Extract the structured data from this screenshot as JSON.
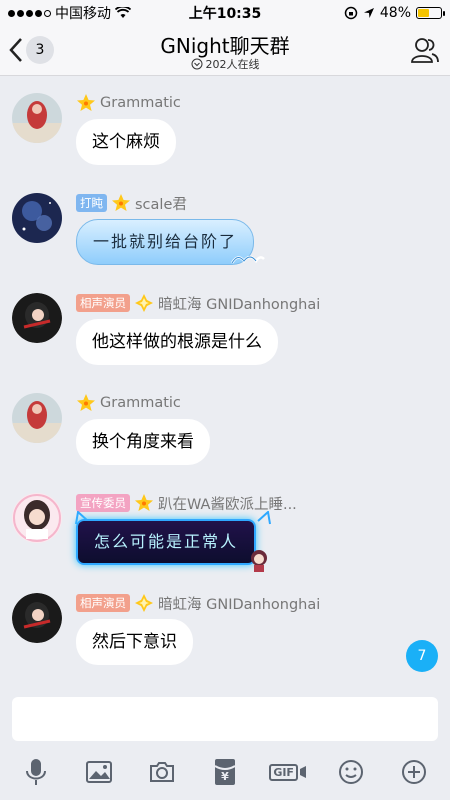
{
  "status_bar": {
    "carrier": "中国移动",
    "time": "上午10:35",
    "battery": "48%",
    "battery_level": 0.48
  },
  "header": {
    "back_count": "3",
    "title": "GNight聊天群",
    "online": "202人在线"
  },
  "messages": [
    {
      "sender": "Grammatic",
      "badge": "",
      "text": "这个麻烦"
    },
    {
      "sender": "scale君",
      "badge": "打盹",
      "text": "一批就别给台阶了"
    },
    {
      "sender": "暗虹海 GNIDanhonghai",
      "badge": "相声演员",
      "text": "他这样做的根源是什么"
    },
    {
      "sender": "Grammatic",
      "badge": "",
      "text": "换个角度来看"
    },
    {
      "sender": "趴在WA酱欧派上睡...",
      "badge": "宣传委员",
      "text": "怎么可能是正常人"
    },
    {
      "sender": "暗虹海 GNIDanhonghai",
      "badge": "相声演员",
      "text": "然后下意识"
    }
  ],
  "unread_count": "7",
  "input": {
    "placeholder": ""
  },
  "toolbar": {
    "icons": [
      "microphone-icon",
      "image-icon",
      "camera-icon",
      "red-packet-icon",
      "gif-icon",
      "emoji-icon",
      "plus-icon"
    ],
    "gif_label": "GIF",
    "yen_label": "¥"
  },
  "colors": {
    "badge_blue": "#7fb6f0",
    "badge_salmon": "#f2a08c",
    "badge_pink": "#f3a3c2",
    "unread": "#1ab0f7"
  }
}
